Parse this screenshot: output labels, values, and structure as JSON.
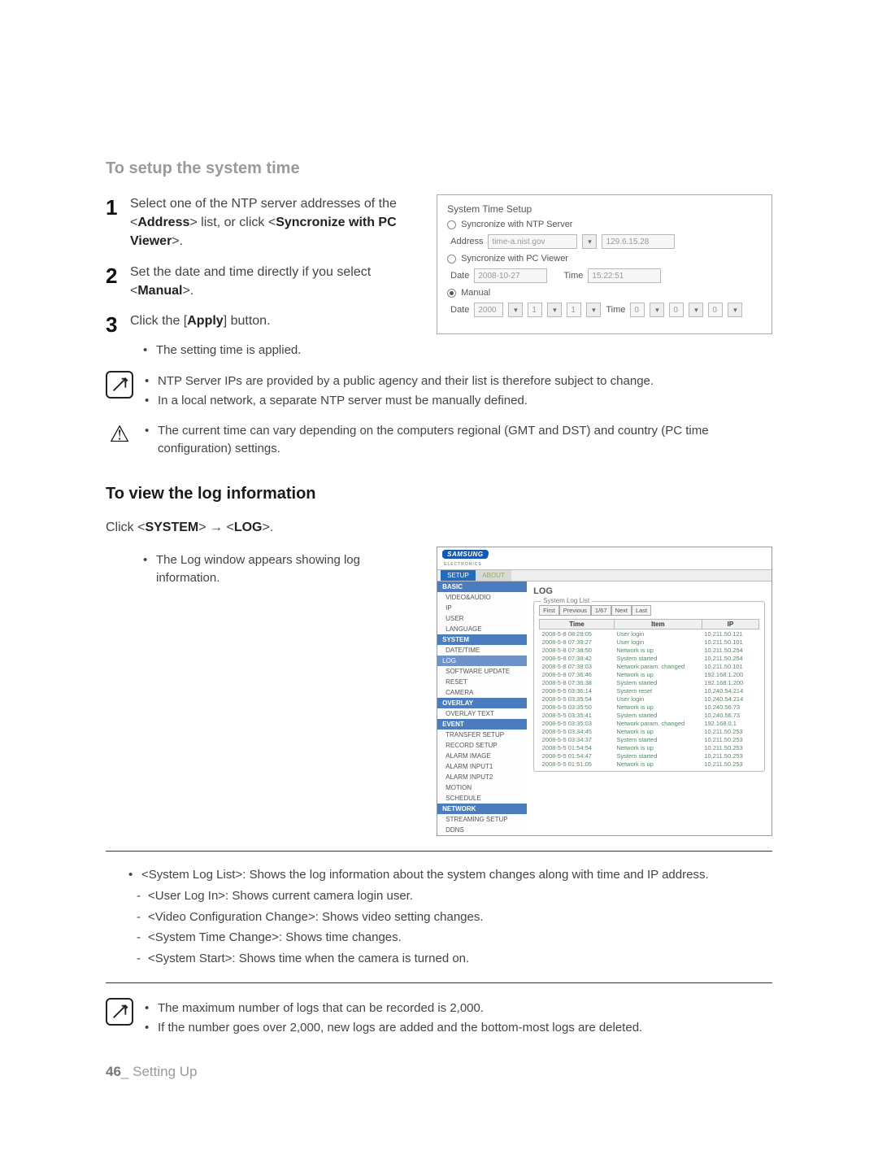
{
  "section1": {
    "title": "To setup the system time",
    "steps": [
      {
        "num": "1",
        "text_pre": "Select one of the NTP server addresses of the <",
        "kw1": "Address",
        "mid": "> list, or click <",
        "kw2": "Syncronize with PC Viewer",
        "post": ">."
      },
      {
        "num": "2",
        "text_pre": "Set the date and time directly if you select <",
        "kw1": "Manual",
        "post": ">."
      },
      {
        "num": "3",
        "text_pre": "Click the [",
        "kw1": "Apply",
        "post": "] button."
      }
    ],
    "sub_bullet": "The setting time is applied.",
    "note1": [
      "NTP Server IPs are provided by a public agency and their list is therefore subject to change.",
      "In a local network, a separate NTP server must be manually defined."
    ],
    "warn1": [
      "The current time can vary depending on the computers regional (GMT and DST) and country (PC time configuration) settings."
    ]
  },
  "sts": {
    "title": "System Time Setup",
    "opt_ntp": "Syncronize with NTP Server",
    "address_lbl": "Address",
    "address_val": "time-a.nist.gov",
    "address_ip": "129.6.15.28",
    "opt_pc": "Syncronize with PC Viewer",
    "date_lbl": "Date",
    "date_val": "2008-10-27",
    "time_lbl": "Time",
    "time_val": "15:22:51",
    "opt_manual": "Manual",
    "manual_date_lbl": "Date",
    "manual_year": "2000",
    "manual_m": "1",
    "manual_d": "1",
    "manual_time_lbl": "Time",
    "manual_h": "0",
    "manual_mi": "0",
    "manual_s": "0"
  },
  "section2": {
    "title": "To view the log information",
    "intro_pre": "Click <",
    "intro_kw1": "SYSTEM",
    "intro_mid": "> → <",
    "intro_kw2": "LOG",
    "intro_post": ">.",
    "bullet": "The Log window appears showing log information.",
    "desc_pre": "<System Log List>: Shows the log information about the system changes along with time and IP address.",
    "dashes": [
      "<User Log In>: Shows current camera login user.",
      "<Video Configuration Change>: Shows video setting changes.",
      "<System Time Change>: Shows time changes.",
      "<System Start>: Shows time when the camera is turned on."
    ],
    "note2": [
      "The maximum number of logs that can be recorded is 2,000.",
      "If the number goes over 2,000, new logs are added and the bottom-most logs are deleted."
    ]
  },
  "logwin": {
    "brand": "SAMSUNG",
    "brand_sub": "ELECTRONICS",
    "tabs": [
      "SETUP",
      "ABOUT"
    ],
    "nav": {
      "basic": "BASIC",
      "basic_items": [
        "VIDEO&AUDIO",
        "IP",
        "USER",
        "LANGUAGE"
      ],
      "system": "SYSTEM",
      "system_items": [
        "DATE/TIME"
      ],
      "system_sel": "LOG",
      "system_rest": [
        "SOFTWARE UPDATE",
        "RESET",
        "CAMERA"
      ],
      "overlay": "OVERLAY",
      "overlay_items": [
        "OVERLAY TEXT"
      ],
      "event": "EVENT",
      "event_items": [
        "TRANSFER SETUP",
        "RECORD SETUP",
        "ALARM IMAGE",
        "ALARM INPUT1",
        "ALARM INPUT2",
        "MOTION",
        "SCHEDULE"
      ],
      "network": "NETWORK",
      "network_items": [
        "STREAMING SETUP",
        "DDNS"
      ]
    },
    "main_title": "LOG",
    "legend": "System Log List",
    "pager": [
      "First",
      "Previous",
      "1/67",
      "Next",
      "Last"
    ],
    "headers": [
      "Time",
      "Item",
      "IP"
    ],
    "rows": [
      [
        "2008-5-8 08:28:05",
        "User login",
        "10.211.50.121"
      ],
      [
        "2008-5-8 07:39:27",
        "User login",
        "10.211.50.101"
      ],
      [
        "2008-5-8 07:38:50",
        "Network is up",
        "10.211.50.254"
      ],
      [
        "2008-5-8 07:38:42",
        "System started",
        "10.211.50.254"
      ],
      [
        "2008-5-8 07:38:03",
        "Network param. changed",
        "10.211.50.101"
      ],
      [
        "2008-5-8 07:36:46",
        "Network is up",
        "192.168.1.200"
      ],
      [
        "2008-5-8 07:36:38",
        "System started",
        "192.168.1.200"
      ],
      [
        "2008-5-5 03:36:14",
        "System reset",
        "10.240.54.214"
      ],
      [
        "2008-5-5 03:35:54",
        "User login",
        "10.240.54.214"
      ],
      [
        "2008-5-5 03:35:50",
        "Network is up",
        "10.240.56.73"
      ],
      [
        "2008-5-5 03:35:41",
        "System started",
        "10.240.56.73"
      ],
      [
        "2008-5-5 03:35:03",
        "Network param. changed",
        "192.168.0.1"
      ],
      [
        "2008-5-5 03:34:45",
        "Network is up",
        "10.211.50.253"
      ],
      [
        "2008-5-5 03:34:37",
        "System started",
        "10.211.50.253"
      ],
      [
        "2008-5-5 01:54:54",
        "Network is up",
        "10.211.50.253"
      ],
      [
        "2008-5-5 01:54:47",
        "System started",
        "10.211.50.253"
      ],
      [
        "2008-5-5 01:51:05",
        "Network is up",
        "10.211.50.253"
      ]
    ]
  },
  "footer": {
    "page": "46",
    "label": "_ Setting Up"
  }
}
